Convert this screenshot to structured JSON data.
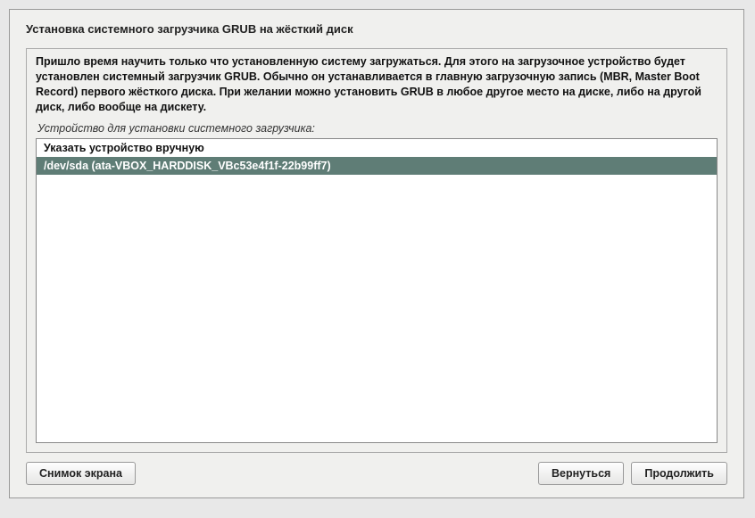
{
  "title": "Установка системного загрузчика GRUB на жёсткий диск",
  "description": "Пришло время научить только что установленную систему загружаться. Для этого на загрузочное устройство будет установлен системный загрузчик GRUB. Обычно он устанавливается в главную загрузочную запись (MBR, Master Boot Record) первого жёсткого диска. При желании можно установить GRUB в любое другое место на диске, либо на другой диск, либо вообще на дискету.",
  "subtitle": "Устройство для установки системного загрузчика:",
  "list": {
    "manual": "Указать устройство вручную",
    "selected": "/dev/sda  (ata-VBOX_HARDDISK_VBc53e4f1f-22b99ff7)"
  },
  "buttons": {
    "screenshot": "Снимок экрана",
    "back": "Вернуться",
    "continue": "Продолжить"
  }
}
